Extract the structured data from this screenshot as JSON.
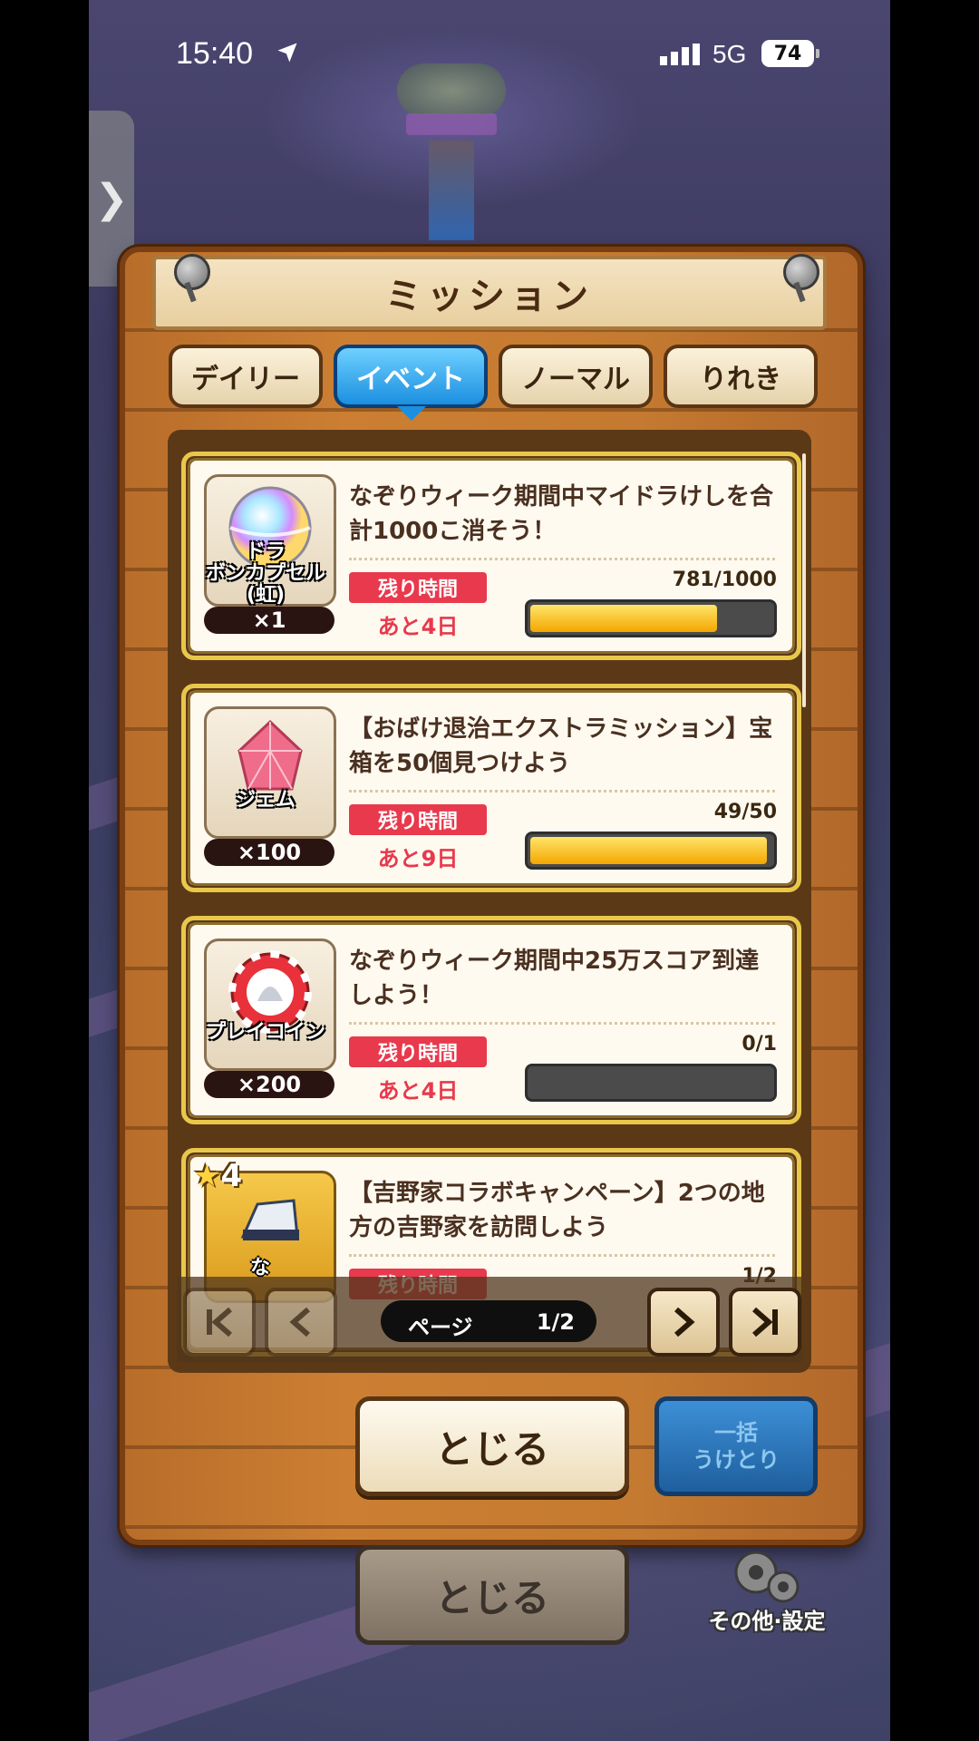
{
  "status_bar": {
    "time": "15:40",
    "network": "5G",
    "battery": "74"
  },
  "side_tab": {
    "label": "❯"
  },
  "dialog": {
    "title": "ミッション",
    "tabs": [
      {
        "label": "デイリー",
        "active": false
      },
      {
        "label": "イベント",
        "active": true
      },
      {
        "label": "ノーマル",
        "active": false
      },
      {
        "label": "りれき",
        "active": false
      }
    ],
    "missions": [
      {
        "reward_name": "ドラ\nボンカプセル(虹)",
        "reward_qty": "×1",
        "description": "なぞりウィーク期間中マイドラけしを合計1000こ消そう！",
        "remain_label": "残り時間",
        "remain_value": "あと4日",
        "progress_text": "781/1000",
        "progress": 0.781
      },
      {
        "reward_name": "ジェム",
        "reward_qty": "×100",
        "description": "【おばけ退治エクストラミッション】宝箱を50個見つけよう",
        "remain_label": "残り時間",
        "remain_value": "あと9日",
        "progress_text": "49/50",
        "progress": 0.98
      },
      {
        "reward_name": "プレイコイン",
        "reward_qty": "×200",
        "description": "なぞりウィーク期間中25万スコア到達しよう！",
        "remain_label": "残り時間",
        "remain_value": "あと4日",
        "progress_text": "0/1",
        "progress": 0
      },
      {
        "reward_name": "な",
        "reward_stars": "4",
        "description": "【吉野家コラボキャンペーン】2つの地方の吉野家を訪問しよう",
        "remain_label": "残り時間",
        "progress_text": "1/2"
      }
    ],
    "pager": {
      "label": "ページ",
      "value": "1/2"
    },
    "close_label": "とじる",
    "receive_all_label": [
      "一括",
      "うけとり"
    ]
  },
  "background": {
    "close_label": "とじる",
    "settings_label": "その他·設定"
  }
}
